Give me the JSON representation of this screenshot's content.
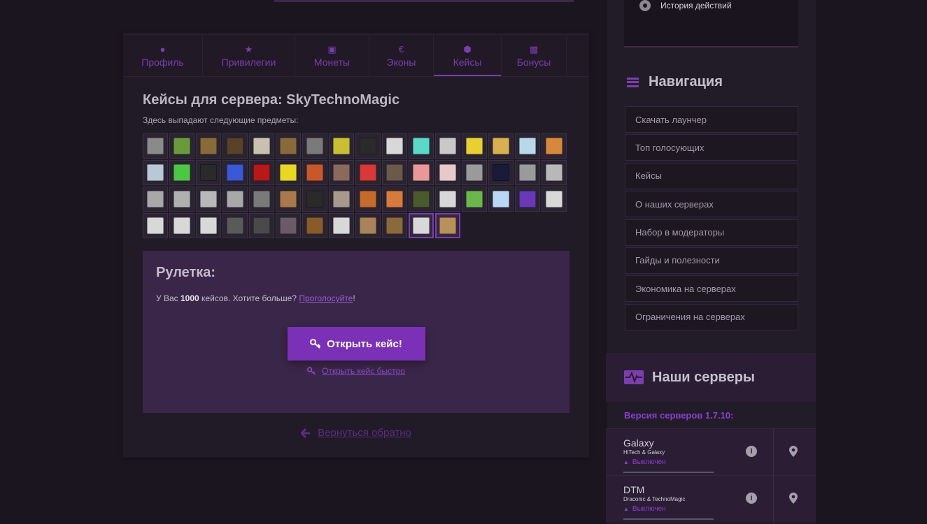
{
  "tabs": [
    {
      "icon": "user-icon",
      "label": "Профиль"
    },
    {
      "icon": "star-icon",
      "label": "Привилегии"
    },
    {
      "icon": "money-icon",
      "label": "Монеты"
    },
    {
      "icon": "euro-icon",
      "label": "Эконы"
    },
    {
      "icon": "cube-icon",
      "label": "Кейсы",
      "active": true
    },
    {
      "icon": "gift-icon",
      "label": "Бонусы"
    }
  ],
  "cases": {
    "title": "Кейсы для сервера: SkyTechnoMagic",
    "subtitle": "Здесь выпадают следующие предметы:",
    "items": [
      "#8a8a8a",
      "#6a9a3a",
      "#8a6a3a",
      "#5a4228",
      "#c9c0b0",
      "#8a6a3a",
      "#7a7a7a",
      "#c9c030",
      "#2a2a2a",
      "#d8d8d8",
      "#5ad8c8",
      "#c8c8c8",
      "#e8d030",
      "#d8b050",
      "#b8d8e8",
      "#d8883a",
      "#b8c8d8",
      "#4ac840",
      "#2a2a2a",
      "#3a58d8",
      "#b81818",
      "#e8d820",
      "#c8582a",
      "#8a6a5a",
      "#d83838",
      "#6a5a4a",
      "#e89898",
      "#e8c8c8",
      "#9a9a9a",
      "#1a1a3a",
      "#9a9a9a",
      "#b8b8b8",
      "#a8a8a8",
      "#b0b0b0",
      "#b8b8b8",
      "#a8a8a8",
      "#7a7a7a",
      "#a87a4a",
      "#2a2a2a",
      "#a89a8a",
      "#c86a2a",
      "#d87a3a",
      "#4a5a2a",
      "#d8d8d8",
      "#6ab84a",
      "#b8d8f8",
      "#6a38b8",
      "#d8d8d8",
      "#d8d8d8",
      "#d8d8d8",
      "#d8d8d8",
      "#5a5a5a",
      "#4a4a4a",
      "#6a5a6a",
      "#8a5a2a",
      "#d8d8d8",
      "#a8845a",
      "#8a6a3a",
      "#d8d8d8",
      "#b8905a"
    ]
  },
  "roulette": {
    "title": "Рулетка:",
    "text_before": "У Вас ",
    "count": "1000",
    "text_after": " кейсов. Хотите больше? ",
    "vote_link": "Проголосуйте",
    "vote_tail": "!",
    "open_button": "Открыть кейс!",
    "fast_link": "Открыть кейс быстро"
  },
  "back_link": "Вернуться обратно",
  "history": {
    "label": "История действий"
  },
  "navigation": {
    "title": "Навигация",
    "items": [
      "Скачать лаунчер",
      "Топ голосующих",
      "Кейсы",
      "О наших серверах",
      "Набор в модераторы",
      "Гайды и полезности",
      "Экономика на серверах",
      "Ограничения на серверах"
    ]
  },
  "servers": {
    "title": "Наши серверы",
    "version": "Версия серверов 1.7.10:",
    "list": [
      {
        "name": "Galaxy",
        "sub": "HiTech & Galaxy",
        "status": "Выключен"
      },
      {
        "name": "DTM",
        "sub": "Draconic & TechnoMagic",
        "status": "Выключен"
      }
    ]
  },
  "colors": {
    "accent": "#7b30b8",
    "bg": "#1b1520",
    "panel": "#211b27"
  }
}
